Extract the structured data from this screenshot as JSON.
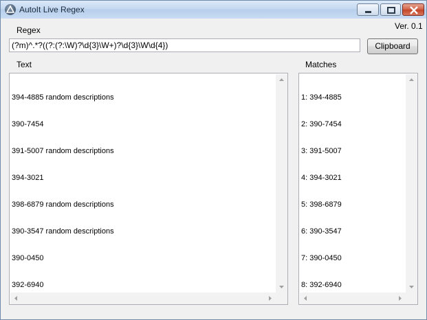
{
  "window": {
    "title": "AutoIt Live Regex",
    "version": "Ver. 0.1"
  },
  "regex": {
    "label": "Regex",
    "value": "(?m)^.*?((?:(?:\\W)?\\d{3}\\W+)?\\d{3}\\W\\d{4})"
  },
  "clipboard_label": "Clipboard",
  "text": {
    "label": "Text",
    "lines": [
      "394-4885 random descriptions",
      "390-7454",
      "391-5007 random descriptions",
      "394-3021",
      "398-6879 random descriptions",
      "390-3547 random descriptions",
      "390-0450",
      "392-6940"
    ]
  },
  "matches": {
    "label": "Matches",
    "lines": [
      "1: 394-4885",
      "2: 390-7454",
      "3: 391-5007",
      "4: 394-3021",
      "5: 398-6879",
      "6: 390-3547",
      "7: 390-0450",
      "8: 392-6940"
    ]
  }
}
